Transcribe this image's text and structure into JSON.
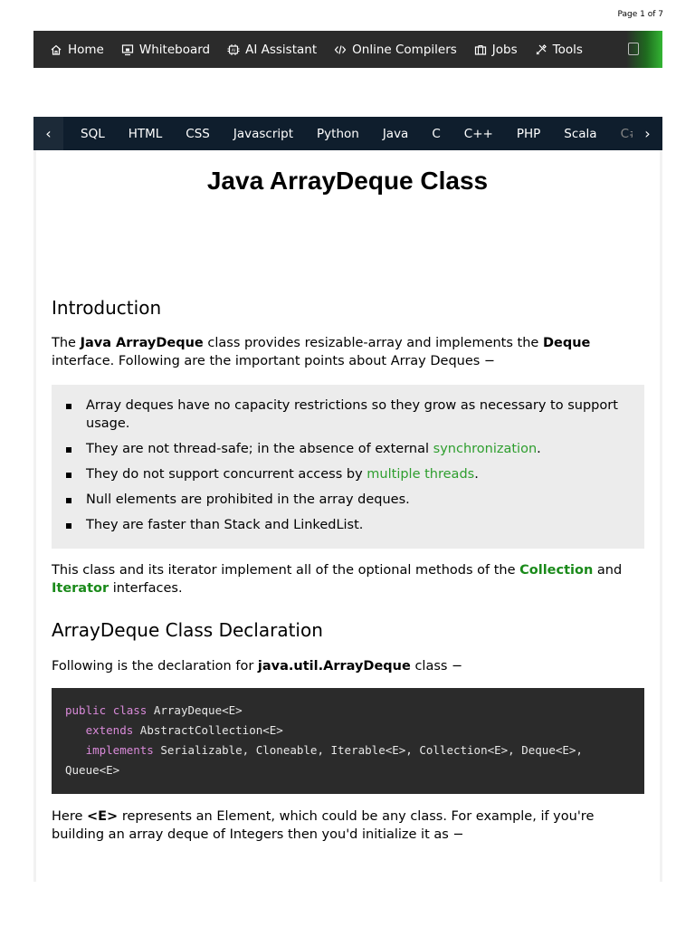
{
  "page_indicator": "Page 1 of 7",
  "top_nav": [
    {
      "label": "Home",
      "icon": "home-icon"
    },
    {
      "label": "Whiteboard",
      "icon": "whiteboard-icon"
    },
    {
      "label": "AI Assistant",
      "icon": "ai-assistant-icon"
    },
    {
      "label": "Online Compilers",
      "icon": "code-icon"
    },
    {
      "label": "Jobs",
      "icon": "briefcase-icon"
    },
    {
      "label": "Tools",
      "icon": "tools-icon"
    }
  ],
  "lang_bar": {
    "prev": "‹",
    "next": "›",
    "items": [
      "SQL",
      "HTML",
      "CSS",
      "Javascript",
      "Python",
      "Java",
      "C",
      "C++",
      "PHP",
      "Scala",
      "C#"
    ]
  },
  "title": "Java ArrayDeque Class",
  "intro": {
    "heading": "Introduction",
    "p1_a": "The ",
    "p1_b": "Java ArrayDeque",
    "p1_c": " class provides resizable-array and implements the ",
    "p1_d": "Deque",
    "p1_e": " interface. Following are the important points about Array Deques −",
    "bullets": {
      "b1": "Array deques have no capacity restrictions so they grow as necessary to support usage.",
      "b2_a": "They are not thread-safe; in the absence of external ",
      "b2_link": "synchronization",
      "b2_b": ".",
      "b3_a": "They do not support concurrent access by ",
      "b3_link": "multiple threads",
      "b3_b": ".",
      "b4": "Null elements are prohibited in the array deques.",
      "b5": "They are faster than Stack and LinkedList."
    },
    "p2_a": "This class and its iterator implement all of the optional methods of the ",
    "p2_link1": "Collection",
    "p2_b": " and ",
    "p2_link2": "Iterator",
    "p2_c": " interfaces."
  },
  "declaration": {
    "heading": "ArrayDeque Class Declaration",
    "p_a": "Following is the declaration for ",
    "p_b": "java.util.ArrayDeque",
    "p_c": " class −",
    "code": {
      "kw_public": "public",
      "kw_class": "class",
      "l1_rest": " ArrayDeque<E>",
      "kw_extends": "extends",
      "l2_rest": " AbstractCollection<E>",
      "kw_implements": "implements",
      "l3_rest": " Serializable, Cloneable, Iterable<E>, Collection<E>, Deque<E>,",
      "l4": "Queue<E>"
    },
    "p2_a": "Here ",
    "p2_b": "<E>",
    "p2_c": " represents an Element, which could be any class. For example, if you're building an array deque of Integers then you'd initialize it as −"
  },
  "colors": {
    "nav_bg": "#2b2b2b",
    "langbar_bg": "#0f1e2d",
    "link_green": "#2e9e2e",
    "code_bg": "#2b2b2b",
    "code_keyword": "#d98ad9"
  }
}
